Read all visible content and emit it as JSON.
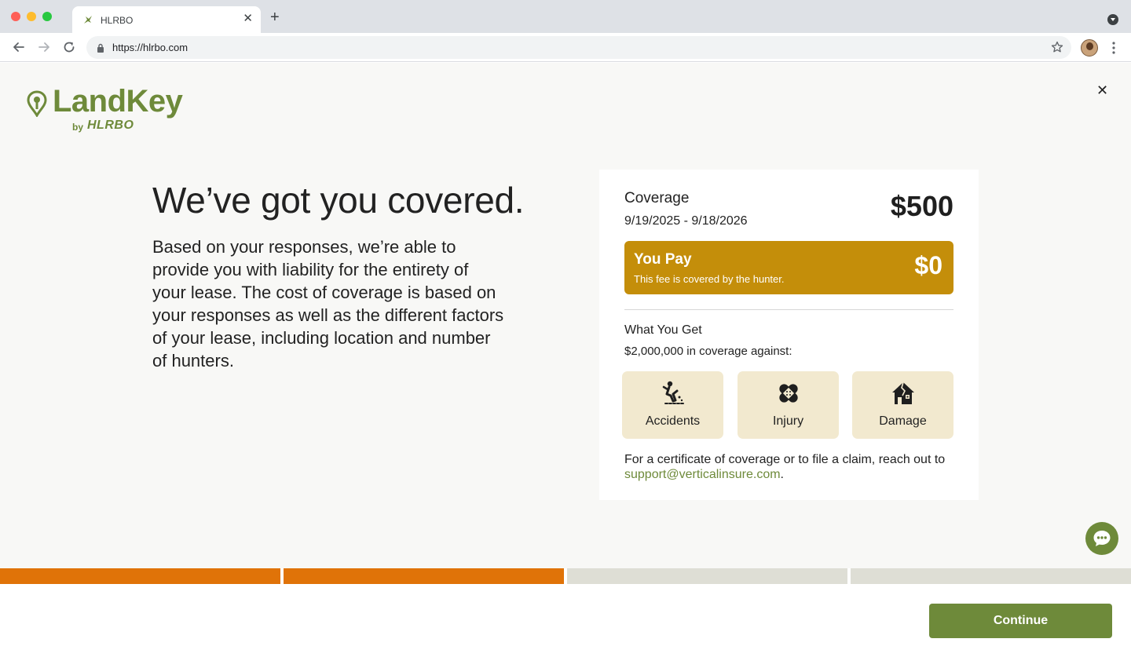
{
  "browser": {
    "tab_title": "HLRBO",
    "url": "https://hlrbo.com",
    "new_tab_label": "+",
    "tab_close_label": "✕"
  },
  "brand": {
    "name": "LandKey",
    "by": "by",
    "parent": "HLRBO",
    "color": "#6e8a3a"
  },
  "page": {
    "close_label": "✕",
    "headline": "We’ve got you covered.",
    "body": "Based on your responses, we’re able to provide you with liability for the entirety of your lease. The cost of coverage is based on your responses as well as the different factors of your lease, including location and number of hunters."
  },
  "coverage": {
    "label": "Coverage",
    "dates": "9/19/2025 - 9/18/2026",
    "amount": "$500",
    "you_pay": {
      "label": "You Pay",
      "note": "This fee is covered by the hunter.",
      "amount": "$0",
      "color": "#c48e0a"
    },
    "what_you_get": {
      "title": "What You Get",
      "description": "$2,000,000 in coverage against:",
      "items": [
        {
          "label": "Accidents",
          "icon": "falling-person-icon"
        },
        {
          "label": "Injury",
          "icon": "bandage-icon"
        },
        {
          "label": "Damage",
          "icon": "damaged-house-icon"
        }
      ]
    },
    "claim_text": "For a certificate of coverage or to file a claim, reach out to",
    "claim_email": "support@verticalinsure.com",
    "claim_suffix": "."
  },
  "progress": {
    "steps_total": 4,
    "steps_completed": 2,
    "active_color": "#e07308",
    "inactive_color": "#deded5"
  },
  "footer": {
    "continue_label": "Continue"
  },
  "chat": {
    "icon": "chat-bubble-icon"
  }
}
